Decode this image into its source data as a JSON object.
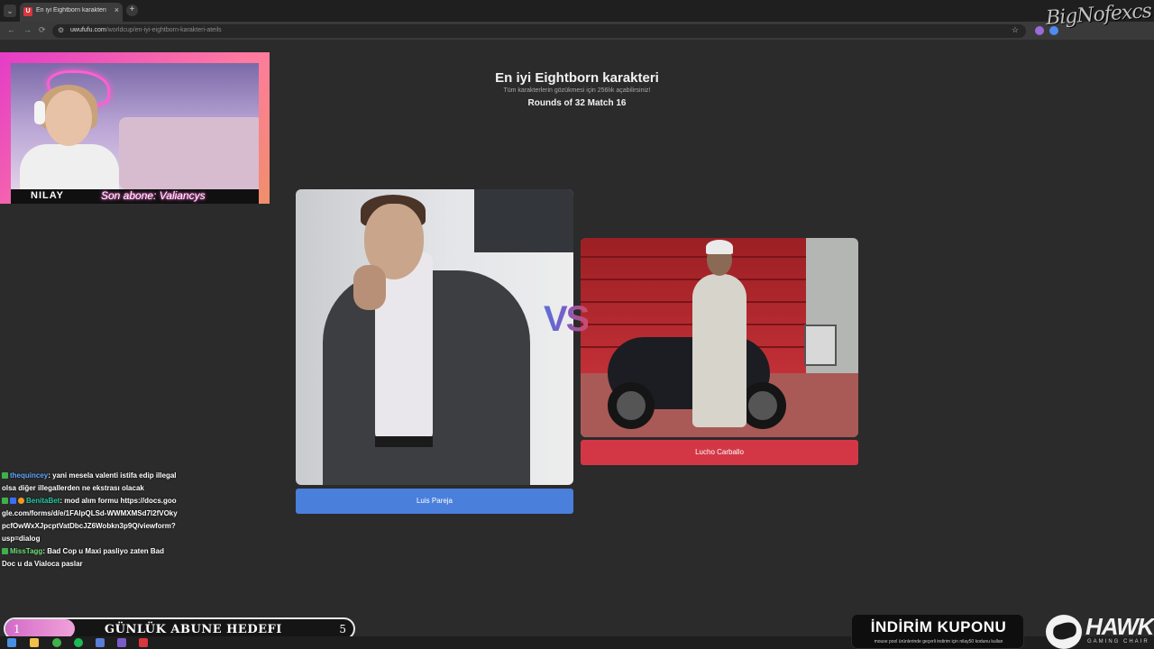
{
  "browser": {
    "tab_title": "En iyi Eightborn karakteri | Uw",
    "tab_close": "×",
    "new_tab": "+",
    "url_host": "uwufufu.com",
    "url_path": "/worldcup/en-iyi-eightborn-karakteri-ateils",
    "back": "←",
    "forward": "→",
    "reload": "⟳",
    "star": "☆"
  },
  "overlay": {
    "watermark": "BigNofexcs",
    "streamer_name": "NILAY",
    "last_sub": "Son abone: Valiancys"
  },
  "page": {
    "title": "En iyi Eightborn karakteri",
    "subtitle": "Tüm karakterlerin gözükmesi için 256lık açabilirsiniz!",
    "round_info": "Rounds of 32 Match 16"
  },
  "match": {
    "left_name": "Luis Pareja",
    "right_name": "Lucho Carballo",
    "vs_label": "VS"
  },
  "chat": [
    {
      "user": "thequincey",
      "text": ": yani mesela valenti istifa edip illegal olsa diğer illegallerden ne ekstrası olacak",
      "badges": [
        "mod"
      ],
      "color": "#5fa8ff"
    },
    {
      "user": "BenitaBet",
      "text": ": mod alım formu https://docs.google.com/forms/d/e/1FAIpQLSd-WWMXMSd7l2fVOkypcfOwWxXJpcptVatDbcJZ6Wobkn3p9Q/viewform?usp=dialog",
      "badges": [
        "mod",
        "blue",
        "orange"
      ],
      "color": "#26c9a5"
    },
    {
      "user": "MissTagg",
      "text": ": Bad Cop u Maxi pasliyo zaten Bad Doc u da Vialoca paslar",
      "badges": [
        "mod"
      ],
      "color": "#6ee07a"
    }
  ],
  "goal": {
    "label": "GÜNLÜK ABUNE HEDEFI",
    "current": "1",
    "target": "5",
    "progress": 0.2
  },
  "coupon": {
    "title": "İNDİRİM KUPONU",
    "subtitle": "mouse pool ürünlerinde geçerli indirim için nilay50 kodunu kullan"
  },
  "sponsor": {
    "name": "HAWK",
    "tagline": "GAMING CHAIR"
  },
  "colors": {
    "left_button": "#4a7fdc",
    "right_button": "#d33746",
    "background": "#2b2b2b"
  }
}
